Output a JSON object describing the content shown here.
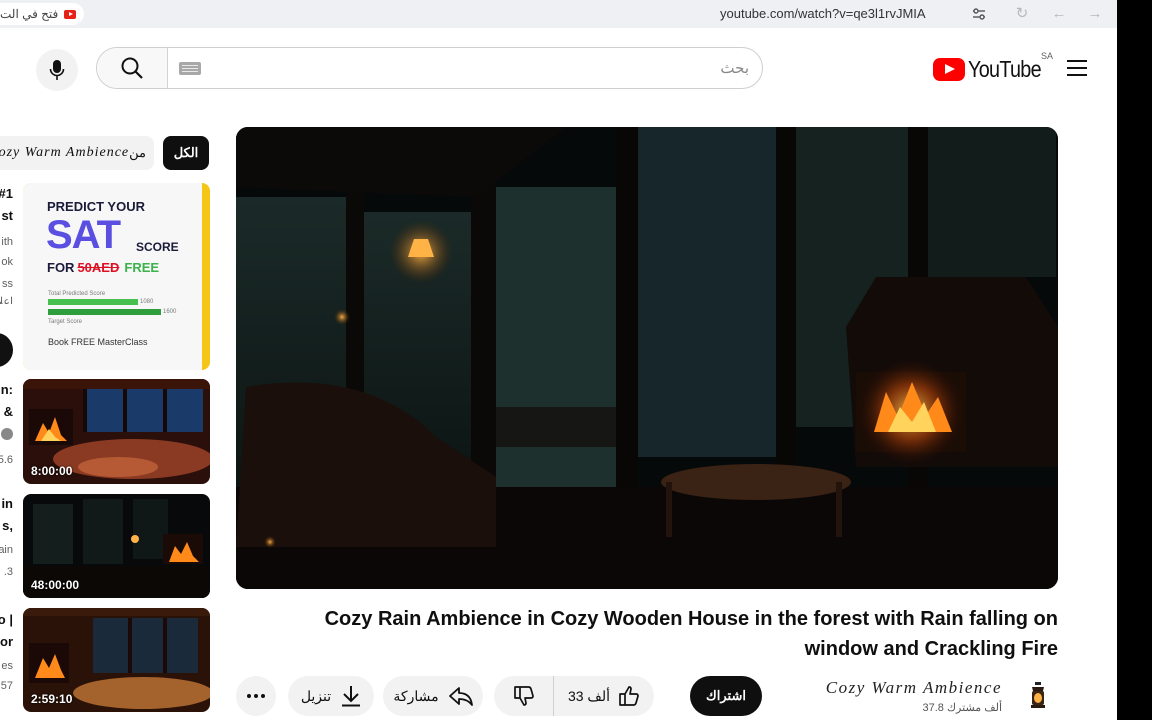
{
  "browser": {
    "open_in_app": "فتح في الت",
    "url": "youtube.com/watch?v=qe3l1rvJMIA"
  },
  "masthead": {
    "search_placeholder": "بحث",
    "logo_text": "YouTube",
    "country_code": "SA"
  },
  "video": {
    "title": "Cozy Rain Ambience in Cozy Wooden House in the forest with Rain falling on window and Crackling Fire",
    "channel": "Cozy Warm Ambience",
    "subscribers": "37.8 ألف مشترك",
    "subscribe_label": "اشتراك",
    "likes": "33 ألف",
    "share_label": "مشاركة",
    "download_label": "تنزيل"
  },
  "sidebar": {
    "chip_all": "الكل",
    "chip_channel_prefix": "من",
    "chip_channel_name": "Cozy Warm Ambience",
    "ad": {
      "predict": "PREDICT YOUR",
      "sat": "SAT",
      "score": "SCORE",
      "for": "FOR",
      "price": "50AED",
      "free": "FREE",
      "total_label": "Total Predicted Score",
      "v1": "1080",
      "v2": "1600",
      "target_label": "Target Score",
      "cta": "Book FREE MasterClass",
      "side_lines": [
        "#1",
        "st",
        "ith",
        "ok",
        "ss",
        "إعلا"
      ]
    },
    "items": [
      {
        "duration": "8:00:00",
        "side_lines": [
          "n:",
          "&",
          "",
          "5.6"
        ]
      },
      {
        "duration": "48:00:00",
        "side_lines": [
          "in",
          "s,",
          "ain",
          ".3"
        ]
      },
      {
        "duration": "2:59:10",
        "side_lines": [
          "o |",
          "or",
          "es",
          "57"
        ]
      }
    ]
  },
  "colors": {
    "brand_red": "#ff0000",
    "subscribe_bg": "#0f0f0f",
    "pill_bg": "#f2f2f2"
  }
}
